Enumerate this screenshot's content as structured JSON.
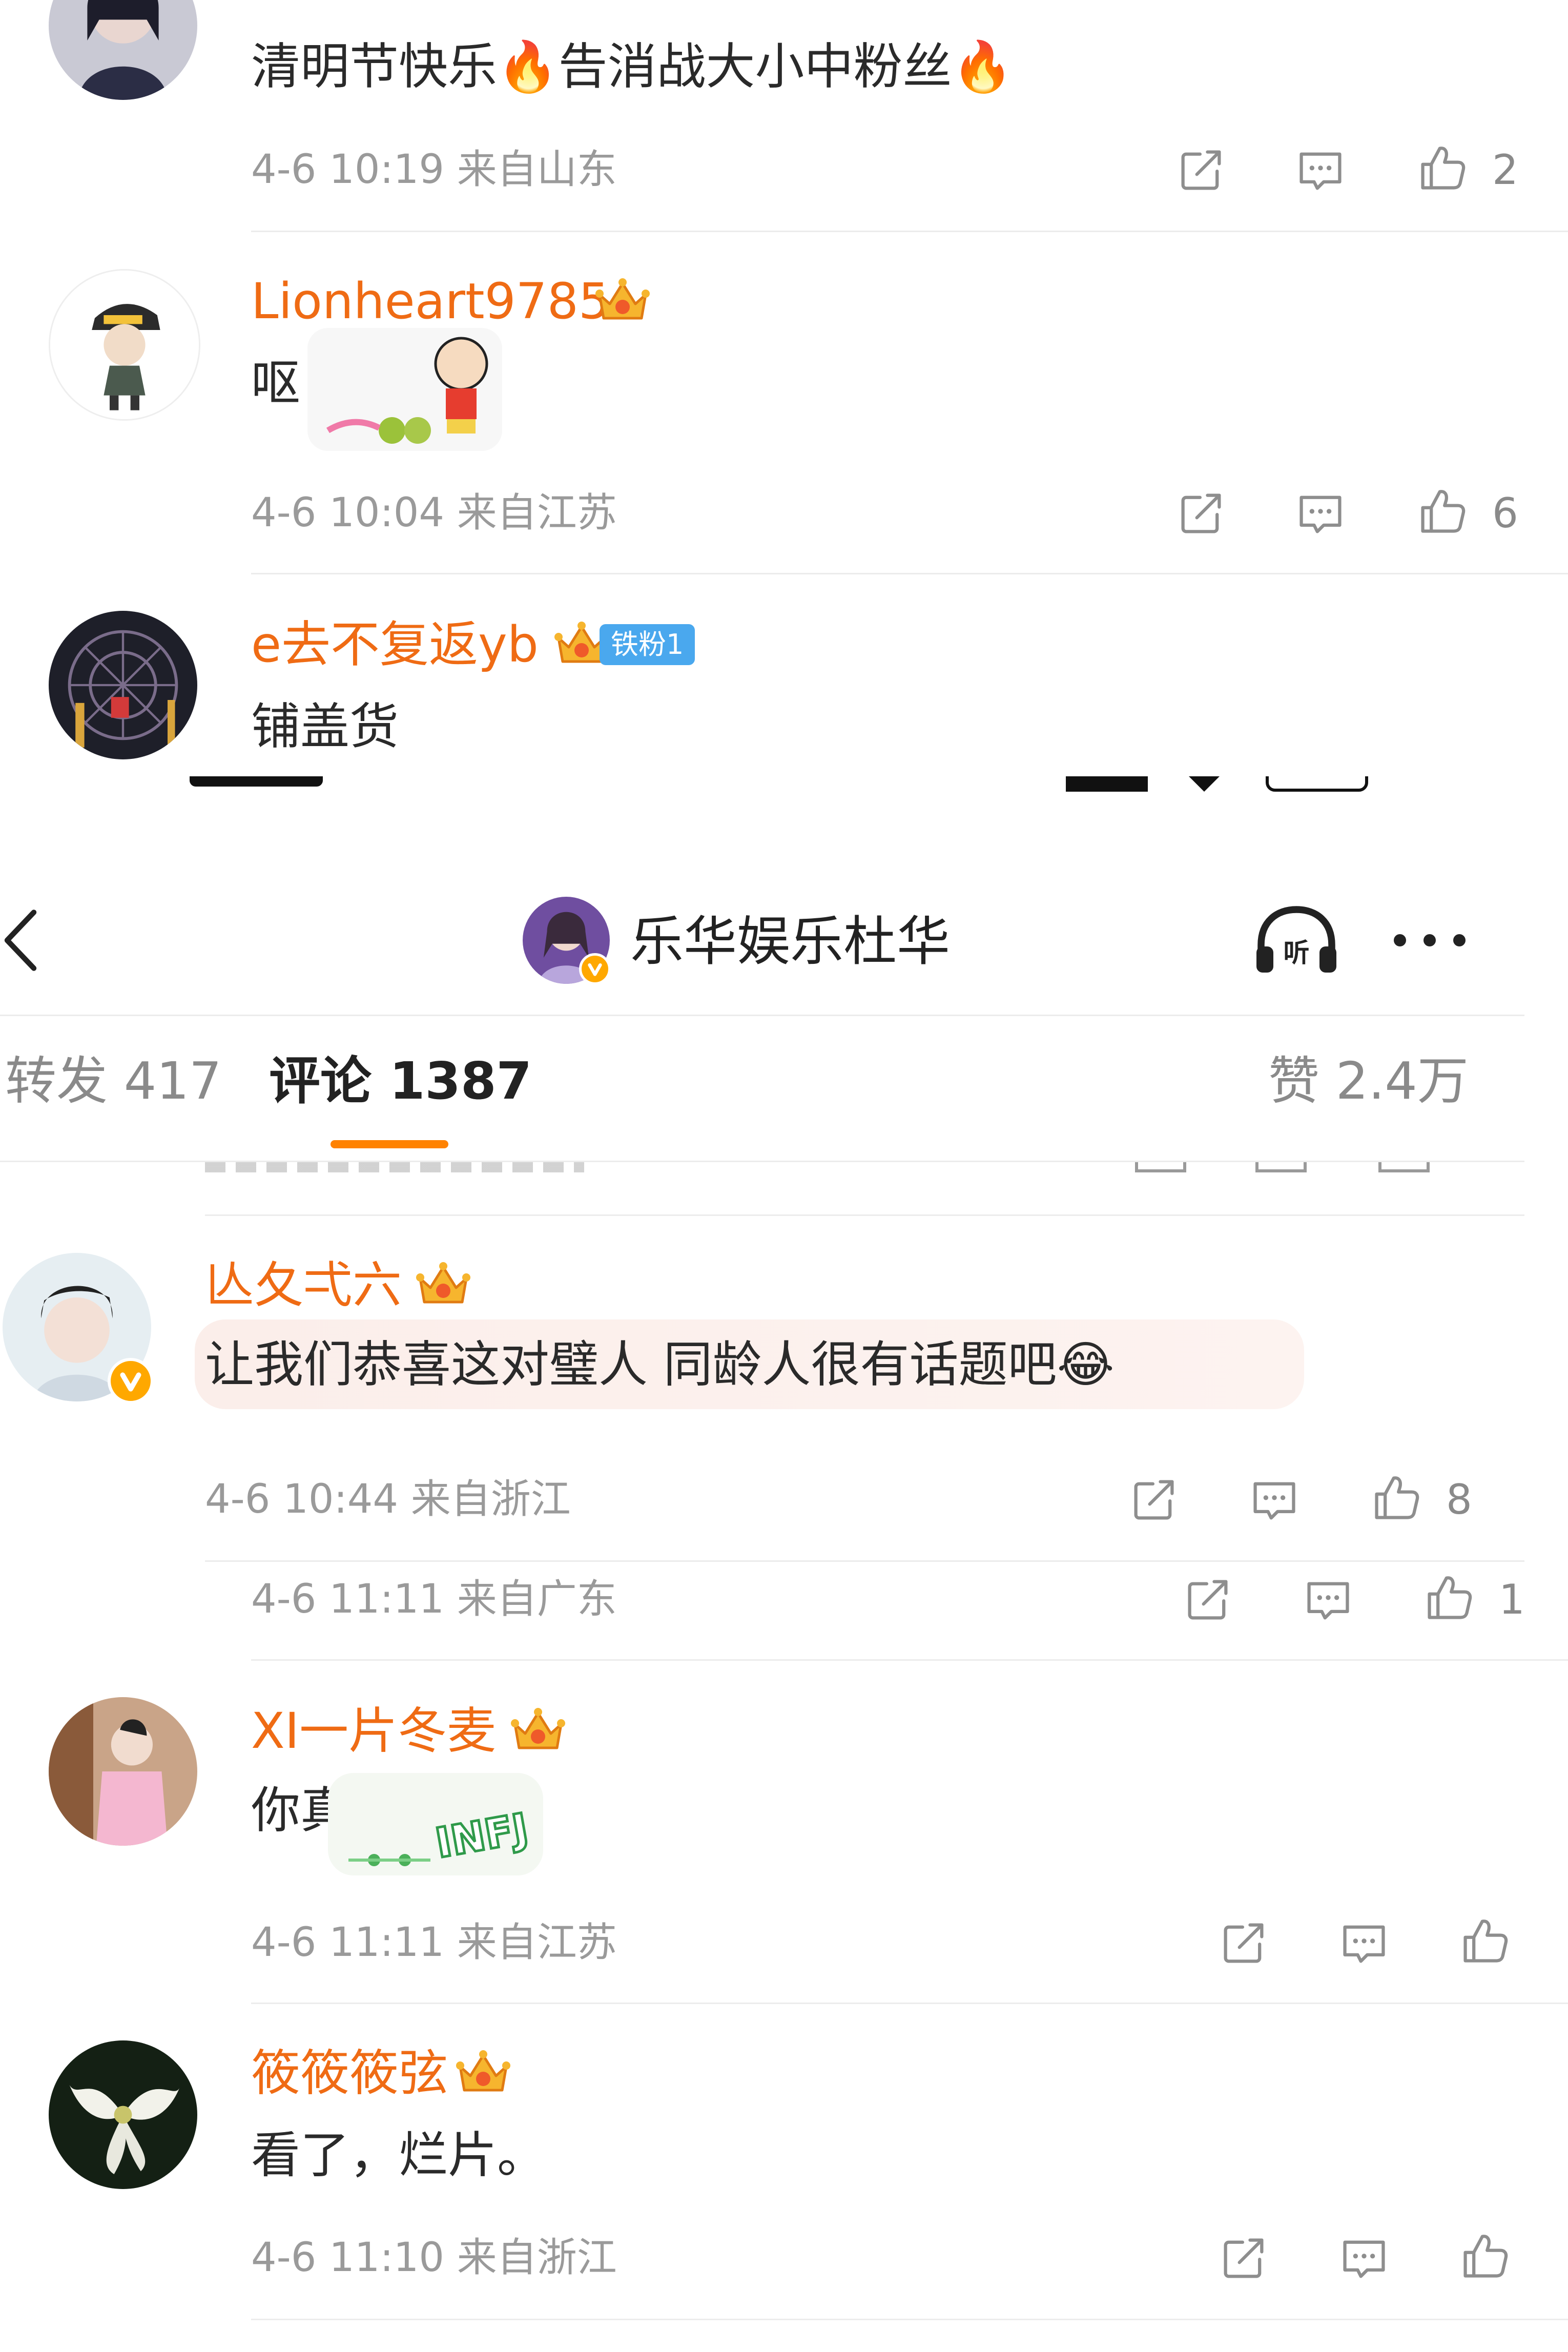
{
  "top_comments": [
    {
      "text": "清明节快乐🔥告消战大小中粉丝🔥",
      "meta": "4-6 10:19 来自山东",
      "likes": "2"
    },
    {
      "username": "Lionheart9785",
      "text": "呕",
      "meta": "4-6 10:04 来自江苏",
      "likes": "6"
    },
    {
      "username": "e去不复返yb",
      "fan_badge": "铁粉1",
      "text": "铺盖货"
    }
  ],
  "header": {
    "title": "乐华娱乐杜华"
  },
  "tabs": {
    "repost": "转发 417",
    "comment": "评论 1387",
    "likes": "赞 2.4万"
  },
  "comments": [
    {
      "username": "亾夂弌六",
      "text": "让我们恭喜这对璧人 同龄人很有话题吧😂",
      "meta": "4-6 10:44 来自浙江",
      "likes": "8"
    },
    {
      "meta": "4-6 11:11 来自广东",
      "likes": "1"
    },
    {
      "username": "XI一片冬麦",
      "text": "你真见",
      "meta": "4-6 11:11 来自江苏"
    },
    {
      "username": "筱筱筱弦",
      "text": "看了，烂片。",
      "meta": "4-6 11:10 来自浙江"
    }
  ],
  "colors": {
    "username": "#ef6b14",
    "accent": "#ff8200",
    "meta": "#9a9a9a",
    "fan_badge": "#4aa8ee"
  }
}
